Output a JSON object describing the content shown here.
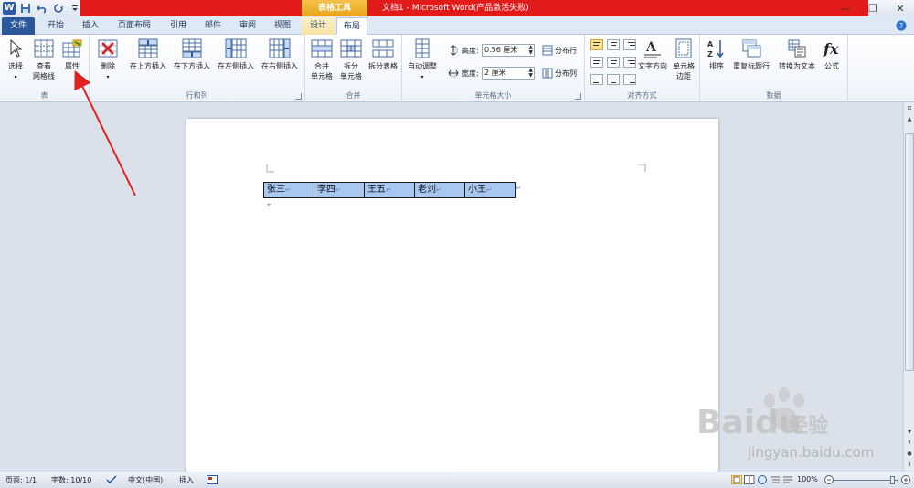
{
  "titlebar": {
    "context_tools": "表格工具",
    "window_title": "文档1 - Microsoft Word(产品激活失败)",
    "minimize": "—",
    "restore": "❐",
    "close": "✕"
  },
  "tabs": {
    "file": "文件",
    "home": "开始",
    "insert": "插入",
    "page_layout": "页面布局",
    "references": "引用",
    "mailings": "邮件",
    "review": "审阅",
    "view": "视图",
    "design": "设计",
    "layout": "布局"
  },
  "ribbon": {
    "table_group": {
      "label": "表",
      "select": "选择",
      "gridlines_1": "查看",
      "gridlines_2": "网格线",
      "properties": "属性"
    },
    "rows_cols_group": {
      "label": "行和列",
      "delete": "删除",
      "insert_above": "在上方插入",
      "insert_below": "在下方插入",
      "insert_left": "在左侧插入",
      "insert_right": "在右侧插入"
    },
    "merge_group": {
      "label": "合并",
      "merge_1": "合并",
      "merge_2": "单元格",
      "split_1": "拆分",
      "split_2": "单元格",
      "split_table": "拆分表格"
    },
    "cell_size_group": {
      "label": "单元格大小",
      "autofit": "自动调整",
      "height_label": "高度:",
      "height_value": "0.56 厘米",
      "width_label": "宽度:",
      "width_value": "2 厘米",
      "distribute_rows": "分布行",
      "distribute_cols": "分布列"
    },
    "alignment_group": {
      "label": "对齐方式",
      "text_direction": "文字方向",
      "cell_margins_1": "单元格",
      "cell_margins_2": "边距"
    },
    "data_group": {
      "label": "数据",
      "sort": "排序",
      "repeat_header": "重复标题行",
      "convert_to_text": "转换为文本",
      "formula": "公式"
    }
  },
  "document": {
    "table_cells": [
      "张三",
      "李四",
      "王五",
      "老刘",
      "小王"
    ],
    "cell_end_mark": "↵",
    "paragraph_mark": "↵"
  },
  "statusbar": {
    "page": "页面: 1/1",
    "words": "字数: 10/10",
    "language": "中文(中国)",
    "insert_mode": "插入",
    "zoom": "100%"
  },
  "watermark": {
    "brand": "Baidu",
    "product": "经验",
    "url": "jingyan.baidu.com"
  },
  "colors": {
    "title_red": "#e11a1a",
    "file_tab_blue": "#2b579a",
    "table_selection": "#a9c8f0",
    "annotation_arrow": "#e0231f"
  }
}
